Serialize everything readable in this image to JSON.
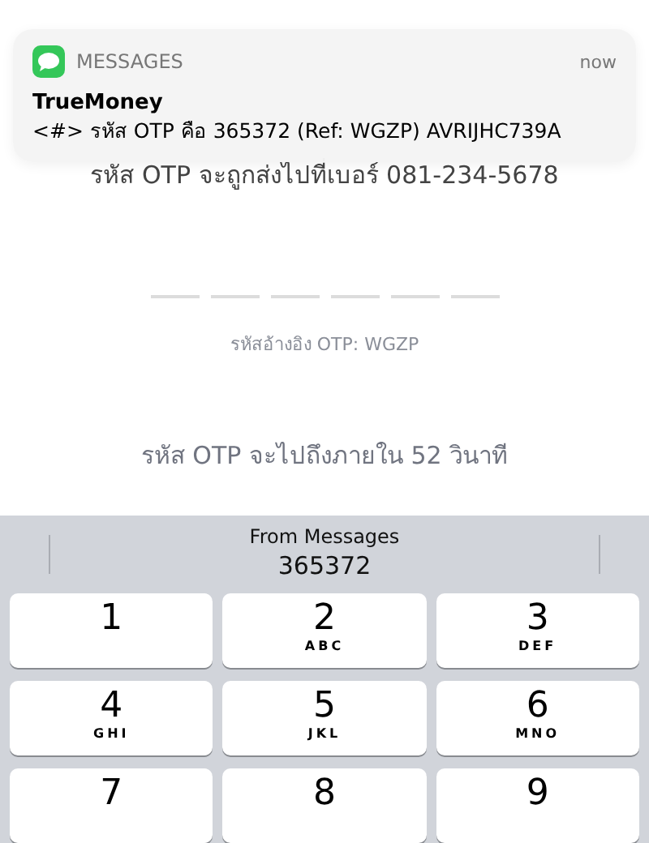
{
  "notification": {
    "app": "MESSAGES",
    "time": "now",
    "sender": "TrueMoney",
    "body": "<#> รหัส OTP คือ 365372 (Ref: WGZP) AVRIJHC739A"
  },
  "page": {
    "sent_to": "รหัส OTP จะถูกส่งไปที่เบอร์ 081-234-5678",
    "otp_slots": [
      {
        "kind": "empty"
      },
      {
        "kind": "empty"
      },
      {
        "kind": "empty"
      },
      {
        "kind": "empty"
      },
      {
        "kind": "empty"
      },
      {
        "kind": "empty"
      }
    ],
    "reference": "รหัสอ้างอิง OTP: WGZP",
    "countdown": "รหัส OTP จะไปถึงภายใน 52 วินาที"
  },
  "keyboard": {
    "suggestion": {
      "source": "From Messages",
      "code": "365372"
    },
    "keys": [
      {
        "digit": "1"
      },
      {
        "digit": "2",
        "letters": "ABC"
      },
      {
        "digit": "3",
        "letters": "DEF"
      },
      {
        "digit": "4",
        "letters": "GHI"
      },
      {
        "digit": "5",
        "letters": "JKL"
      },
      {
        "digit": "6",
        "letters": "MNO"
      },
      {
        "digit": "7"
      },
      {
        "digit": "8"
      },
      {
        "digit": "9"
      }
    ]
  }
}
